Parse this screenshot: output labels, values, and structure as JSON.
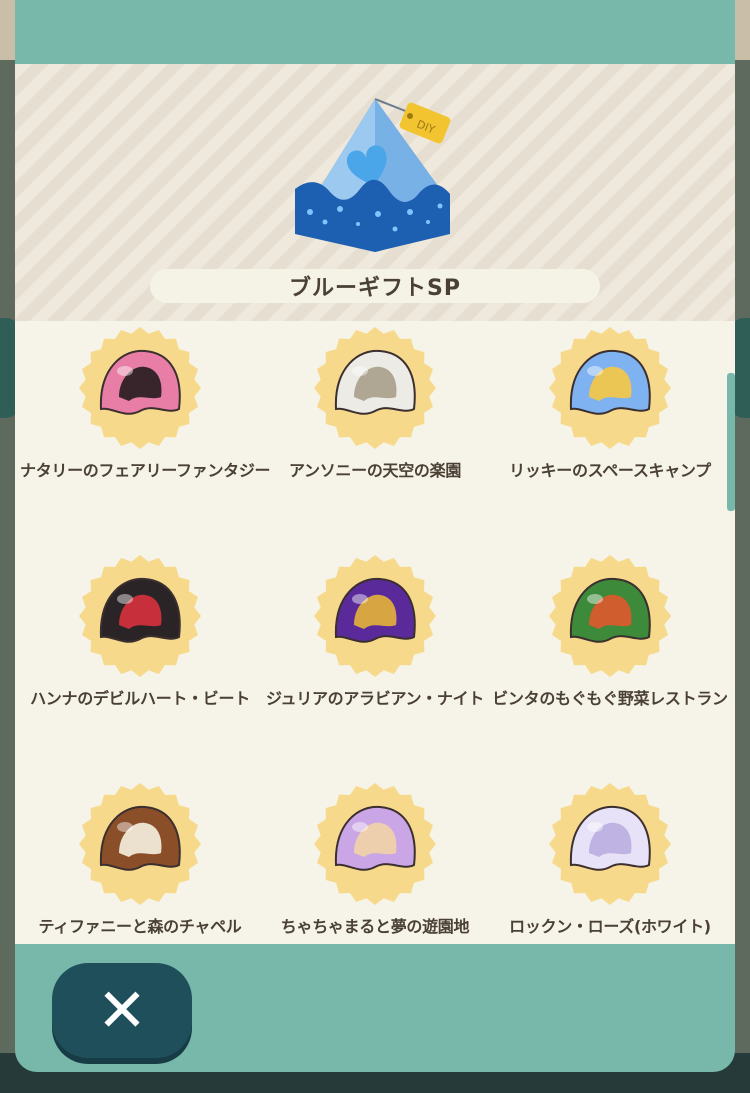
{
  "gift": {
    "name": "ブルーギフトSP",
    "icon": "blue-gift-box-icon"
  },
  "items": [
    {
      "label": "ナタリーのフェアリーファンタジー",
      "icon": "butterfly-wing-cap-icon",
      "colors": [
        "#e87ea6",
        "#231c1e"
      ]
    },
    {
      "label": "アンソニーの天空の楽園",
      "icon": "white-gold-swirl-cap-icon",
      "colors": [
        "#ecebe6",
        "#a9a08a"
      ]
    },
    {
      "label": "リッキーのスペースキャンプ",
      "icon": "blue-star-cap-icon",
      "colors": [
        "#7eb2f0",
        "#f7c844"
      ]
    },
    {
      "label": "ハンナのデビルハート・ビート",
      "icon": "black-heart-bolt-cap-icon",
      "colors": [
        "#2a2426",
        "#d8323e"
      ]
    },
    {
      "label": "ジュリアのアラビアン・ナイト",
      "icon": "purple-arabian-cap-icon",
      "colors": [
        "#5a2a9a",
        "#e4b43a"
      ]
    },
    {
      "label": "ビンタのもぐもぐ野菜レストラン",
      "icon": "vegetable-cap-icon",
      "colors": [
        "#3d8a3a",
        "#e0582c"
      ]
    },
    {
      "label": "ティファニーと森のチャペル",
      "icon": "forest-chapel-cap-icon",
      "colors": [
        "#8a4e28",
        "#f5f2e0"
      ]
    },
    {
      "label": "ちゃちゃまると夢の遊園地",
      "icon": "pastel-dream-cap-icon",
      "colors": [
        "#caa6e6",
        "#f2d4a6"
      ]
    },
    {
      "label": "ロックン・ローズ(ホワイト)",
      "icon": "white-rose-cap-icon",
      "colors": [
        "#e7e2f7",
        "#b9aee0"
      ]
    }
  ],
  "close_button": {
    "label": "✕",
    "icon": "close-icon"
  },
  "theme": {
    "teal": "#78b8aa",
    "dark_teal": "#1f4f5a",
    "badge": "#f7d98c",
    "text": "#4a4034"
  }
}
